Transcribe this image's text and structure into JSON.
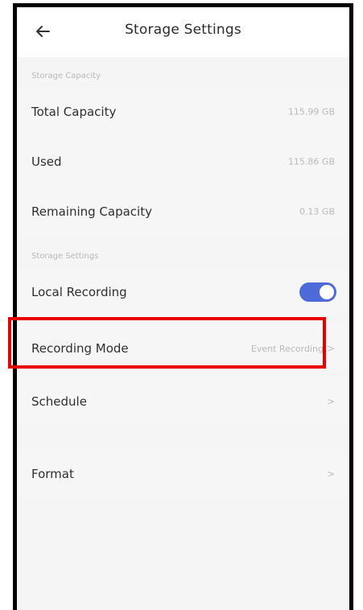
{
  "header": {
    "title": "Storage Settings"
  },
  "sections": {
    "capacity_label": "Storage Capacity",
    "settings_label": "Storage Settings"
  },
  "capacity": {
    "total_label": "Total Capacity",
    "total_value": "115.99 GB",
    "used_label": "Used",
    "used_value": "115.86 GB",
    "remaining_label": "Remaining Capacity",
    "remaining_value": "0.13 GB"
  },
  "settings": {
    "local_recording_label": "Local Recording",
    "local_recording_enabled": true,
    "recording_mode_label": "Recording Mode",
    "recording_mode_value": "Event Recording",
    "schedule_label": "Schedule",
    "format_label": "Format"
  },
  "icons": {
    "back": "back-arrow-icon",
    "chevron": "chevron-right-icon"
  },
  "colors": {
    "toggle_on": "#4d6bd8",
    "highlight": "#e60000"
  }
}
